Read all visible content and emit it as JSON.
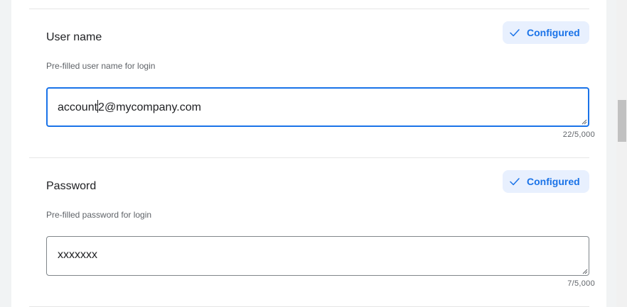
{
  "fields": [
    {
      "title": "User name",
      "description": "Pre-filled user name for login",
      "badge": "Configured",
      "value_before_caret": "account",
      "value_after_caret": "2@mycompany.com",
      "counter": "22/5,000"
    },
    {
      "title": "Password",
      "description": "Pre-filled password for login",
      "badge": "Configured",
      "value": "xxxxxxx",
      "counter": "7/5,000"
    }
  ],
  "colors": {
    "accent": "#1a73e8",
    "badge_bg": "#e8f0fe"
  },
  "icons": {
    "badge_icon": "check-icon"
  }
}
